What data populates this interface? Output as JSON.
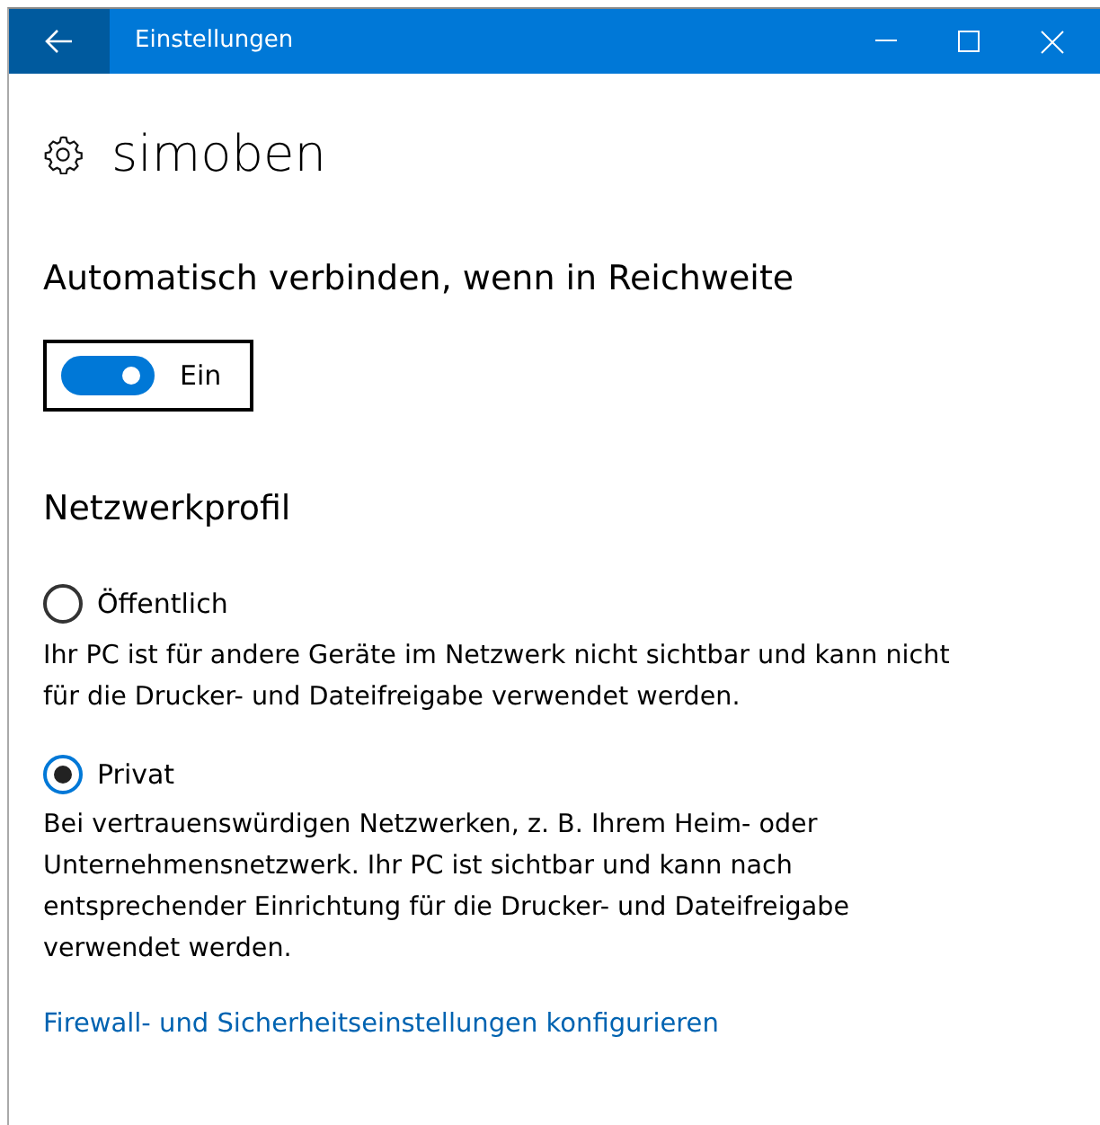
{
  "window": {
    "title": "Einstellungen"
  },
  "page": {
    "title": "simoben"
  },
  "auto_connect": {
    "heading": "Automatisch verbinden, wenn in Reichweite",
    "on": true,
    "label": "Ein"
  },
  "network_profile": {
    "heading": "Netzwerkprofil",
    "options": [
      {
        "label": "Öffentlich",
        "selected": false,
        "description": "Ihr PC ist für andere Geräte im Netzwerk nicht sichtbar und kann nicht für die Drucker- und Dateifreigabe verwendet werden."
      },
      {
        "label": "Privat",
        "selected": true,
        "description": "Bei vertrauenswürdigen Netzwerken, z. B. Ihrem Heim- oder Unternehmensnetzwerk. Ihr PC ist sichtbar und kann nach entsprechender Einrichtung für die Drucker- und Dateifreigabe verwendet werden."
      }
    ]
  },
  "link": "Firewall- und Sicherheitseinstellungen konfigurieren"
}
